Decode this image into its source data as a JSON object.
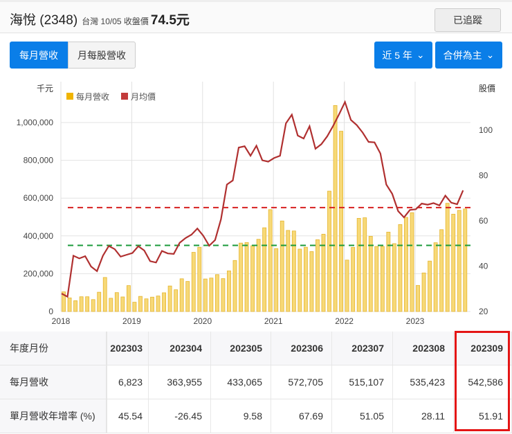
{
  "header": {
    "name": "海悅 (2348)",
    "market": "台灣 10/05 收盤價",
    "close_price": "74.5元",
    "track_button": "已追蹤"
  },
  "tabs": [
    {
      "label": "每月營收",
      "active": true
    },
    {
      "label": "月每股營收",
      "active": false
    }
  ],
  "dropdowns": {
    "period": "近 5 年",
    "basis": "合併為主"
  },
  "chart_data": {
    "type": "bar+line",
    "left_axis_title": "千元",
    "right_axis_title": "股價",
    "legend": [
      {
        "name": "每月營收",
        "color": "#f0b400"
      },
      {
        "name": "月均價",
        "color": "#c23b3b"
      }
    ],
    "left_ticks": [
      "0",
      "200,000",
      "400,000",
      "600,000",
      "800,000",
      "1,000,000"
    ],
    "left_tick_values": [
      0,
      200000,
      400000,
      600000,
      800000,
      1000000
    ],
    "right_ticks": [
      "20",
      "40",
      "60",
      "80",
      "100"
    ],
    "right_tick_values": [
      20,
      40,
      60,
      80,
      100
    ],
    "ylim_left": [
      0,
      1000000
    ],
    "ylim_right": [
      20,
      100
    ],
    "x_labels": [
      "2018",
      "2019",
      "2020",
      "2021",
      "2022",
      "2023"
    ],
    "start": "2018-01",
    "revenue": [
      104000,
      72000,
      57000,
      78000,
      78000,
      63000,
      102000,
      180000,
      70000,
      100000,
      77000,
      137000,
      49000,
      80000,
      67000,
      76000,
      82000,
      99000,
      135000,
      115000,
      173000,
      159000,
      313000,
      340000,
      172000,
      177000,
      195000,
      174000,
      215000,
      270000,
      362000,
      365000,
      348000,
      382000,
      443000,
      539000,
      333000,
      479000,
      429000,
      426000,
      330000,
      340000,
      317000,
      380000,
      409000,
      637000,
      1090000,
      954000,
      272000,
      339000,
      493000,
      496000,
      398000,
      344000,
      344000,
      420000,
      359000,
      460000,
      498000,
      523000,
      138000,
      204000,
      266823,
      363955,
      433065,
      572705,
      515107,
      535423,
      542586
    ],
    "price": [
      27.9,
      26.5,
      44.6,
      43.4,
      44.4,
      39.8,
      37.8,
      44.6,
      48.9,
      47.5,
      44.2,
      45,
      45.8,
      48.8,
      46.9,
      42.2,
      41.6,
      46.7,
      45.6,
      45.4,
      50.3,
      52.4,
      53.9,
      56.6,
      53.4,
      49,
      51.5,
      60.7,
      76,
      77.8,
      92.3,
      92.9,
      88.7,
      93.1,
      86.7,
      86.1,
      87.7,
      88.7,
      103,
      106.8,
      97.6,
      96.3,
      101.7,
      91.8,
      93.8,
      97.3,
      101.9,
      107,
      112.4,
      104.5,
      102.2,
      98.9,
      94.8,
      94.6,
      89.7,
      76,
      71.9,
      64.3,
      61.5,
      64.8,
      65.1,
      67.6,
      67.1,
      67.8,
      66.8,
      71.1,
      68,
      67.3,
      73.4
    ],
    "reference_lines": [
      {
        "color": "#d61f1f",
        "value": 550000
      },
      {
        "color": "#1a9a3a",
        "value": 350000
      }
    ]
  },
  "table": {
    "row_labels": [
      "年度月份",
      "每月營收",
      "單月營收年增率 (%)"
    ],
    "columns": [
      {
        "month": "202303",
        "revenue": "6,823",
        "yoy": "45.54"
      },
      {
        "month": "202304",
        "revenue": "363,955",
        "yoy": "-26.45"
      },
      {
        "month": "202305",
        "revenue": "433,065",
        "yoy": "9.58"
      },
      {
        "month": "202306",
        "revenue": "572,705",
        "yoy": "67.69"
      },
      {
        "month": "202307",
        "revenue": "515,107",
        "yoy": "51.05"
      },
      {
        "month": "202308",
        "revenue": "535,423",
        "yoy": "28.11"
      },
      {
        "month": "202309",
        "revenue": "542,586",
        "yoy": "51.91"
      }
    ],
    "highlight_color": "#e41515"
  }
}
